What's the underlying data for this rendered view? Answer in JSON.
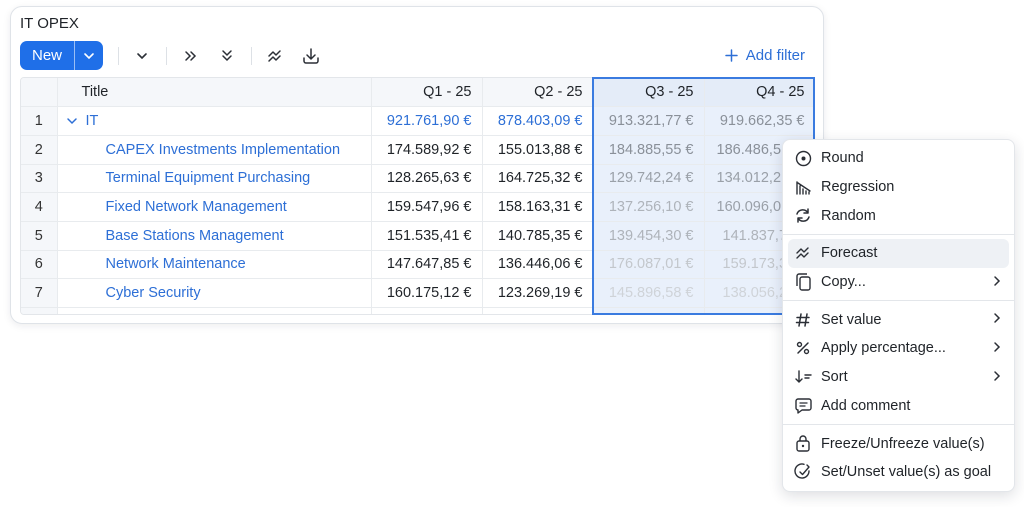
{
  "card": {
    "title": "IT OPEX"
  },
  "toolbar": {
    "new_label": "New",
    "add_filter_label": "Add filter",
    "icons": [
      "chevron-down-icon",
      "expand-right-icon",
      "expand-all-icon",
      "forecast-icon",
      "download-icon"
    ]
  },
  "grid": {
    "columns": [
      "",
      "Title",
      "Q1 - 25",
      "Q2 - 25",
      "Q3 - 25",
      "Q4 - 25"
    ],
    "rows": [
      {
        "n": "1",
        "title": "IT",
        "q1": "921.761,90 €",
        "q2": "878.403,09 €",
        "q3": "913.321,77 €",
        "q4": "919.662,35 €"
      },
      {
        "n": "2",
        "title": "CAPEX Investments Implementation",
        "q1": "174.589,92 €",
        "q2": "155.013,88 €",
        "q3": "184.885,55 €",
        "q4": "186.486,5"
      },
      {
        "n": "3",
        "title": "Terminal Equipment Purchasing",
        "q1": "128.265,63 €",
        "q2": "164.725,32 €",
        "q3": "129.742,24 €",
        "q4": "134.012,2"
      },
      {
        "n": "4",
        "title": "Fixed Network Management",
        "q1": "159.547,96 €",
        "q2": "158.163,31 €",
        "q3": "137.256,10 €",
        "q4": "160.096,0"
      },
      {
        "n": "5",
        "title": "Base Stations Management",
        "q1": "151.535,41 €",
        "q2": "140.785,35 €",
        "q3": "139.454,30 €",
        "q4": "141.837,7"
      },
      {
        "n": "6",
        "title": "Network Maintenance",
        "q1": "147.647,85 €",
        "q2": "136.446,06 €",
        "q3": "176.087,01 €",
        "q4": "159.173,3"
      },
      {
        "n": "7",
        "title": "Cyber Security",
        "q1": "160.175,12 €",
        "q2": "123.269,19 €",
        "q3": "145.896,58 €",
        "q4": "138.056,2"
      }
    ]
  },
  "context_menu": {
    "items": [
      {
        "label": "Round",
        "icon": "round-icon"
      },
      {
        "label": "Regression",
        "icon": "regression-icon"
      },
      {
        "label": "Random",
        "icon": "random-icon"
      },
      {
        "label": "Forecast",
        "icon": "forecast-icon"
      },
      {
        "label": "Copy...",
        "icon": "copy-icon"
      },
      {
        "label": "Set value",
        "icon": "hash-icon"
      },
      {
        "label": "Apply percentage...",
        "icon": "percent-icon"
      },
      {
        "label": "Sort",
        "icon": "sort-icon"
      },
      {
        "label": "Add comment",
        "icon": "comment-icon"
      },
      {
        "label": "Freeze/Unfreeze value(s)",
        "icon": "lock-icon"
      },
      {
        "label": "Set/Unset value(s) as goal",
        "icon": "goal-icon"
      }
    ]
  },
  "colors": {
    "accent": "#1f6fe8",
    "link": "#2d6fd6",
    "selection": "#e9f0fb",
    "selection_border": "#3a7be0"
  }
}
